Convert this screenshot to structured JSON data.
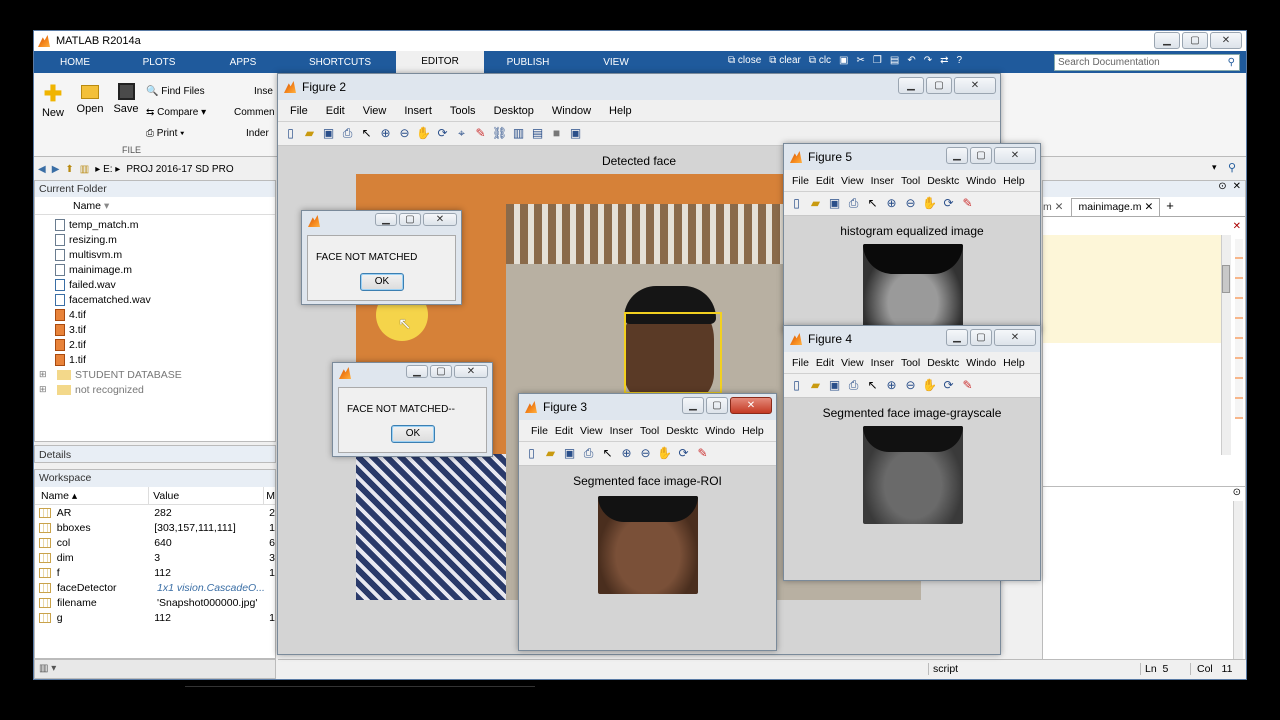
{
  "app": {
    "title": "MATLAB R2014a"
  },
  "tabs": [
    "HOME",
    "PLOTS",
    "APPS",
    "SHORTCUTS",
    "EDITOR",
    "PUBLISH",
    "VIEW"
  ],
  "quick": {
    "close": "close",
    "clear": "clear",
    "clc": "clc"
  },
  "search": {
    "placeholder": "Search Documentation"
  },
  "ribbon": {
    "new": "New",
    "open": "Open",
    "save": "Save",
    "find_files": "Find Files",
    "compare": "Compare",
    "print": "Print",
    "file_group": "FILE",
    "insert": "Inse",
    "comment": "Commen",
    "indent": "Inder"
  },
  "path": {
    "root": "E:",
    "folder": "PROJ 2016-17 SD PRO"
  },
  "current_folder": {
    "title": "Current Folder",
    "col_name": "Name",
    "items": [
      "temp_match.m",
      "resizing.m",
      "multisvm.m",
      "mainimage.m",
      "failed.wav",
      "facematched.wav",
      "4.tif",
      "3.tif",
      "2.tif",
      "1.tif"
    ],
    "folders": [
      "STUDENT DATABASE",
      "not recognized"
    ]
  },
  "details": {
    "title": "Details"
  },
  "workspace": {
    "title": "Workspace",
    "col_name": "Name",
    "col_value": "Value",
    "col_3": "M",
    "rows": [
      {
        "name": "AR",
        "value": "282",
        "c3": "2"
      },
      {
        "name": "bboxes",
        "value": "[303,157,111,111]",
        "c3": "1"
      },
      {
        "name": "col",
        "value": "640",
        "c3": "6"
      },
      {
        "name": "dim",
        "value": "3",
        "c3": "3"
      },
      {
        "name": "f",
        "value": "112",
        "c3": "1"
      },
      {
        "name": "faceDetector",
        "value": "1x1 vision.CascadeO...",
        "c3": ""
      },
      {
        "name": "filename",
        "value": "'Snapshot000000.jpg'",
        "c3": ""
      },
      {
        "name": "g",
        "value": "112",
        "c3": "1"
      }
    ]
  },
  "editor": {
    "tab_partial": "m",
    "tab_main": "mainimage.m",
    "plus": "+"
  },
  "status": {
    "mode": "script",
    "ln_label": "Ln",
    "ln": "5",
    "col_label": "Col",
    "col": "11"
  },
  "figure_menu": [
    "File",
    "Edit",
    "View",
    "Insert",
    "Tools",
    "Desktop",
    "Window",
    "Help"
  ],
  "figure_menu_small": [
    "File",
    "Edit",
    "View",
    "Inser",
    "Tool",
    "Desktc",
    "Windo",
    "Help"
  ],
  "fig2": {
    "title": "Figure 2",
    "plot_title": "Detected face"
  },
  "fig3": {
    "title": "Figure 3",
    "plot_title": "Segmented face image-ROI"
  },
  "fig4": {
    "title": "Figure 4",
    "plot_title": "Segmented face image-grayscale"
  },
  "fig5": {
    "title": "Figure 5",
    "plot_title": "histogram equalized image"
  },
  "dialog1": {
    "message": "FACE NOT MATCHED",
    "ok": "OK"
  },
  "dialog2": {
    "message": "FACE NOT MATCHED--",
    "ok": "OK"
  }
}
